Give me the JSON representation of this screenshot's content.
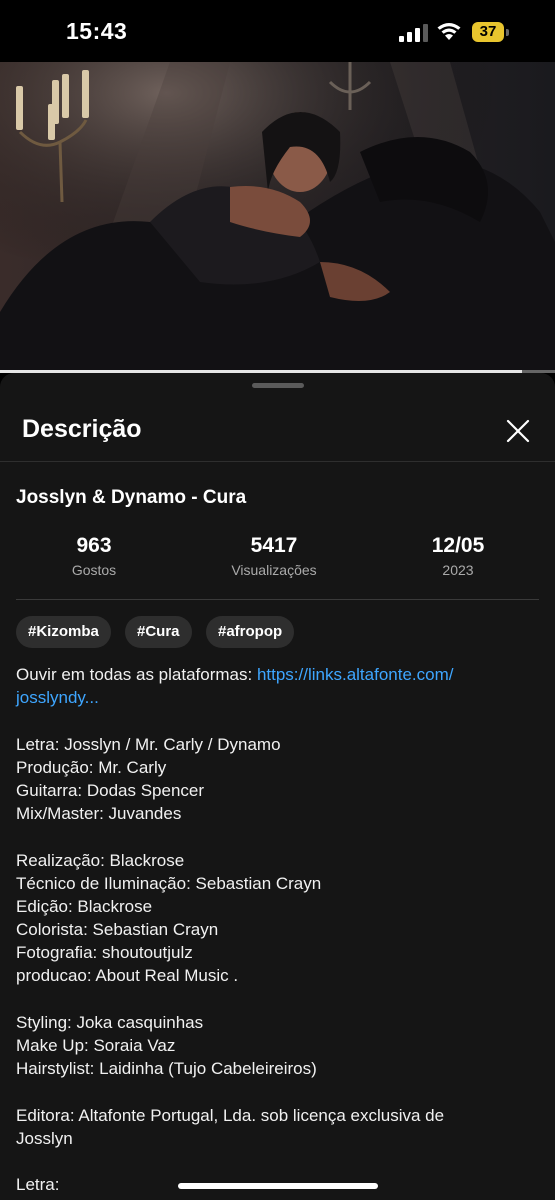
{
  "status_bar": {
    "time": "15:43",
    "battery_level": "37",
    "battery_color": "#e8c52e"
  },
  "video": {
    "progress_fraction": 0.94
  },
  "sheet": {
    "title": "Descrição",
    "close_icon": "close-icon"
  },
  "video_info": {
    "title": "Josslyn & Dynamo - Cura",
    "likes_value": "963",
    "likes_label": "Gostos",
    "views_value": "5417",
    "views_label": "Visualizações",
    "date_value": "12/05",
    "date_year": "2023"
  },
  "tags": [
    "#Kizomba",
    "#Cura",
    "#afropop"
  ],
  "description": {
    "intro_text": "Ouvir em todas as plataformas: ",
    "link_line1": "https://links.altafonte.com/",
    "link_line2": "josslyndy...",
    "credits_1": [
      "Letra: Josslyn / Mr. Carly / Dynamo",
      "Produção: Mr. Carly",
      "Guitarra: Dodas Spencer",
      "Mix/Master: Juvandes"
    ],
    "credits_2": [
      "Realização: Blackrose",
      "Técnico de Iluminação: Sebastian Crayn",
      "Edição: Blackrose",
      "Colorista: Sebastian Crayn",
      "Fotografia: shoutoutjulz",
      "producao: About Real Music ."
    ],
    "credits_3": [
      "Styling: Joka casquinhas",
      "Make Up: Soraia Vaz",
      "Hairstylist: Laidinha (Tujo Cabeleireiros)"
    ],
    "credits_4": [
      "Editora: Altafonte Portugal, Lda. sob licença exclusiva de",
      "Josslyn"
    ],
    "credits_5": [
      "Letra:"
    ]
  },
  "colors": {
    "link": "#3ea6ff",
    "sheet_background": "#151515",
    "tag_background": "#2e2e2e"
  }
}
